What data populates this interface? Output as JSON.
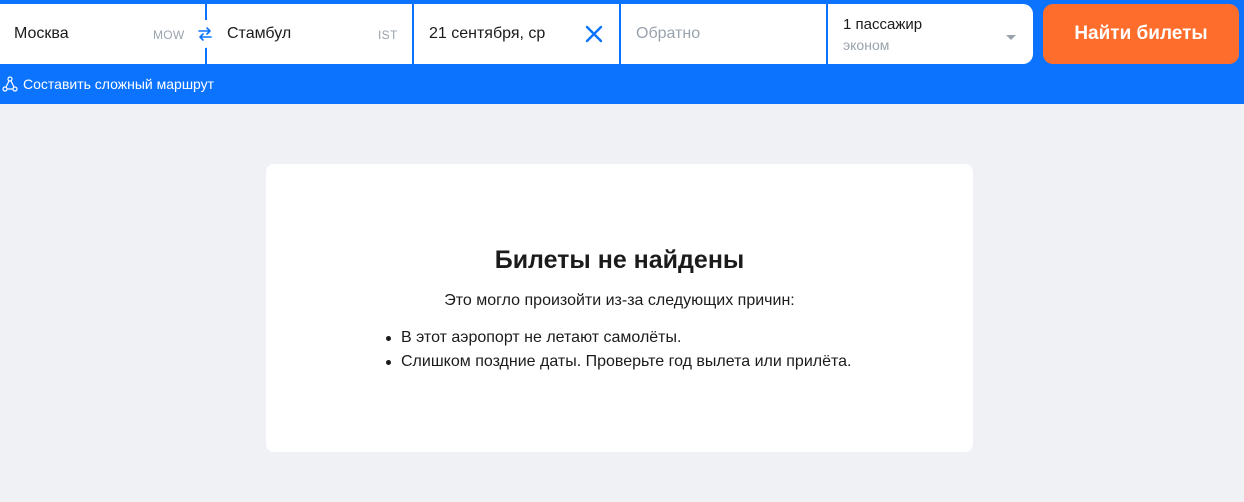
{
  "search": {
    "origin": {
      "city": "Москва",
      "iata": "MOW"
    },
    "destination": {
      "city": "Стамбул",
      "iata": "IST"
    },
    "depart_date": "21 сентября, ср",
    "return_placeholder": "Обратно",
    "passengers": {
      "count_label": "1 пассажир",
      "class_label": "эконом"
    },
    "submit_label": "Найти билеты",
    "complex_route_label": "Составить сложный маршрут"
  },
  "result": {
    "title": "Билеты не найдены",
    "subtitle": "Это могло произойти из-за следующих причин:",
    "reasons": [
      "В этот аэропорт не летают самолёты.",
      "Слишком поздние даты. Проверьте год вылета или прилёта."
    ]
  },
  "colors": {
    "brand_blue": "#0c73fe",
    "accent_orange": "#ff6d2d",
    "background": "#eff1f4"
  },
  "icons": {
    "swap": "swap-arrows-icon",
    "clear": "close-icon",
    "route": "route-nodes-icon",
    "dropdown": "chevron-down-icon"
  }
}
